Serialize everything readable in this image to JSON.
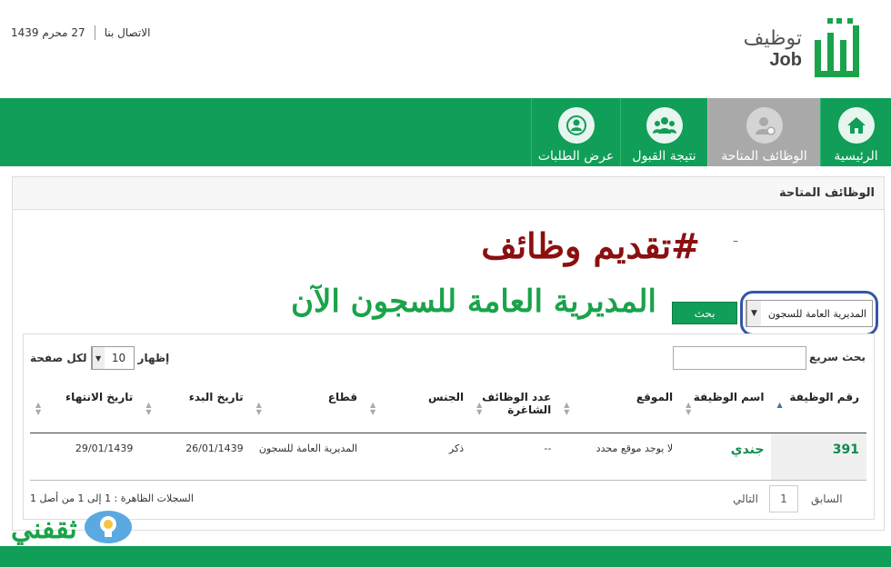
{
  "header": {
    "logo_ar": "توظيف",
    "logo_en": "Job",
    "date": "27 محرم 1439",
    "contact": "الاتصال بنا"
  },
  "nav": [
    {
      "label": "الرئيسية",
      "icon": "home-icon"
    },
    {
      "label": "الوظائف المتاحة",
      "icon": "user-icon",
      "active": true
    },
    {
      "label": "نتيجة القبول",
      "icon": "group-icon"
    },
    {
      "label": "عرض الطلبات",
      "icon": "applications-icon"
    }
  ],
  "panel": {
    "title": "الوظائف المتاحة"
  },
  "overlay": {
    "line1": "#تقديم وظائف",
    "dash": "–",
    "line2": "المديرية العامة للسجون الآن"
  },
  "filter": {
    "selected": "المديرية العامة للسجون",
    "search_button": "بحث"
  },
  "table_controls": {
    "quick_search_label": "بحث سريع :",
    "show_label": "إظهار",
    "page_size": "10",
    "per_page_label": "لكل صفحة"
  },
  "table": {
    "headers": [
      "رقم الوظيفة",
      "اسم الوظيفة",
      "الموقع",
      "عدد الوظائف الشاغرة",
      "الجنس",
      "قطاع",
      "تاريخ البدء",
      "تاريخ الانتهاء"
    ],
    "rows": [
      [
        "391",
        "جندي",
        "لا يوجد موقع محدد",
        "--",
        "ذكر",
        "المديرية العامة للسجون",
        "26/01/1439",
        "29/01/1439"
      ]
    ]
  },
  "footer": {
    "records_info": "السجلات الظاهرة : 1 إلى 1 من أصل 1",
    "prev": "السابق",
    "page": "1",
    "next": "التالي"
  },
  "watermark": {
    "text": "ثقفني"
  },
  "colors": {
    "primary_green": "#109e58",
    "active_nav": "#a9a9a9",
    "overlay_red": "#8b1010",
    "overlay_green": "#1aa34a",
    "ring_blue": "#3355aa"
  }
}
